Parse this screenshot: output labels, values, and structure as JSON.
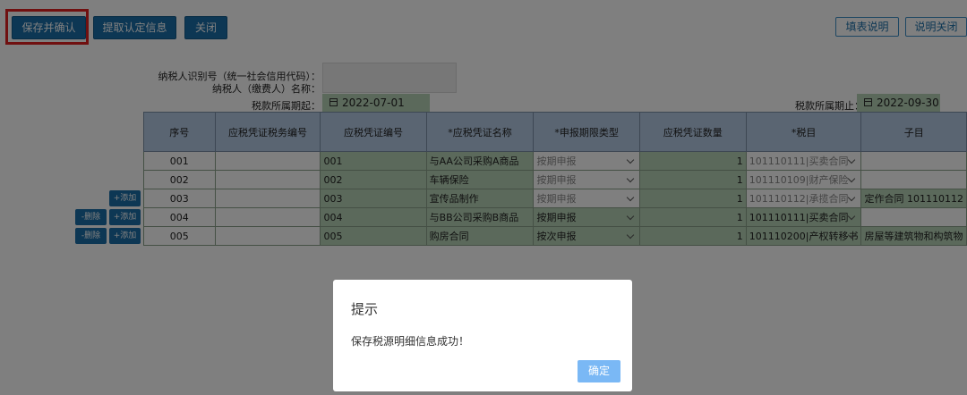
{
  "toolbar": {
    "save_confirm": "保存并确认",
    "fetch_cert": "提取认定信息",
    "close": "关闭",
    "fill_guide": "填表说明",
    "guide_close": "说明关闭"
  },
  "header": {
    "taxid_label": "纳税人识别号（统一社会信用代码）：",
    "name_label": "纳税人（缴费人）名称：",
    "period_start_label": "税款所属期起：",
    "period_start": "2022-07-01",
    "period_end_label": "税款所属期止：",
    "period_end": "2022-09-30"
  },
  "table": {
    "columns": [
      "序号",
      "应税凭证税务编号",
      "应税凭证编号",
      "*应税凭证名称",
      "*申报期限类型",
      "应税凭证数量",
      "*税目",
      "子目"
    ],
    "rows": [
      {
        "seq": "001",
        "tax_no": "",
        "cert_no": "001",
        "name": "与AA公司采购A商品",
        "period_type": "按期申报",
        "qty": "1",
        "item": "101110111|买卖合同",
        "sub": ""
      },
      {
        "seq": "002",
        "tax_no": "",
        "cert_no": "002",
        "name": "车辆保险",
        "period_type": "按期申报",
        "qty": "1",
        "item": "101110109|财产保险",
        "sub": ""
      },
      {
        "seq": "003",
        "tax_no": "",
        "cert_no": "003",
        "name": "宣传品制作",
        "period_type": "按期申报",
        "qty": "1",
        "item": "101110112|承揽合同",
        "sub": "定作合同 101110112"
      },
      {
        "seq": "004",
        "tax_no": "",
        "cert_no": "004",
        "name": "与BB公司采购B商品",
        "period_type": "按期申报",
        "qty": "1",
        "item": "101110111|买卖合同",
        "sub": ""
      },
      {
        "seq": "005",
        "tax_no": "",
        "cert_no": "005",
        "name": "购房合同",
        "period_type": "按次申报",
        "qty": "1",
        "item": "101110200|产权转移书",
        "sub": "房屋等建筑物和构筑物"
      }
    ]
  },
  "row_actions": {
    "add": "+添加",
    "delete": "-删除"
  },
  "modal": {
    "title": "提示",
    "message": "保存税源明细信息成功！",
    "ok": "确定"
  }
}
